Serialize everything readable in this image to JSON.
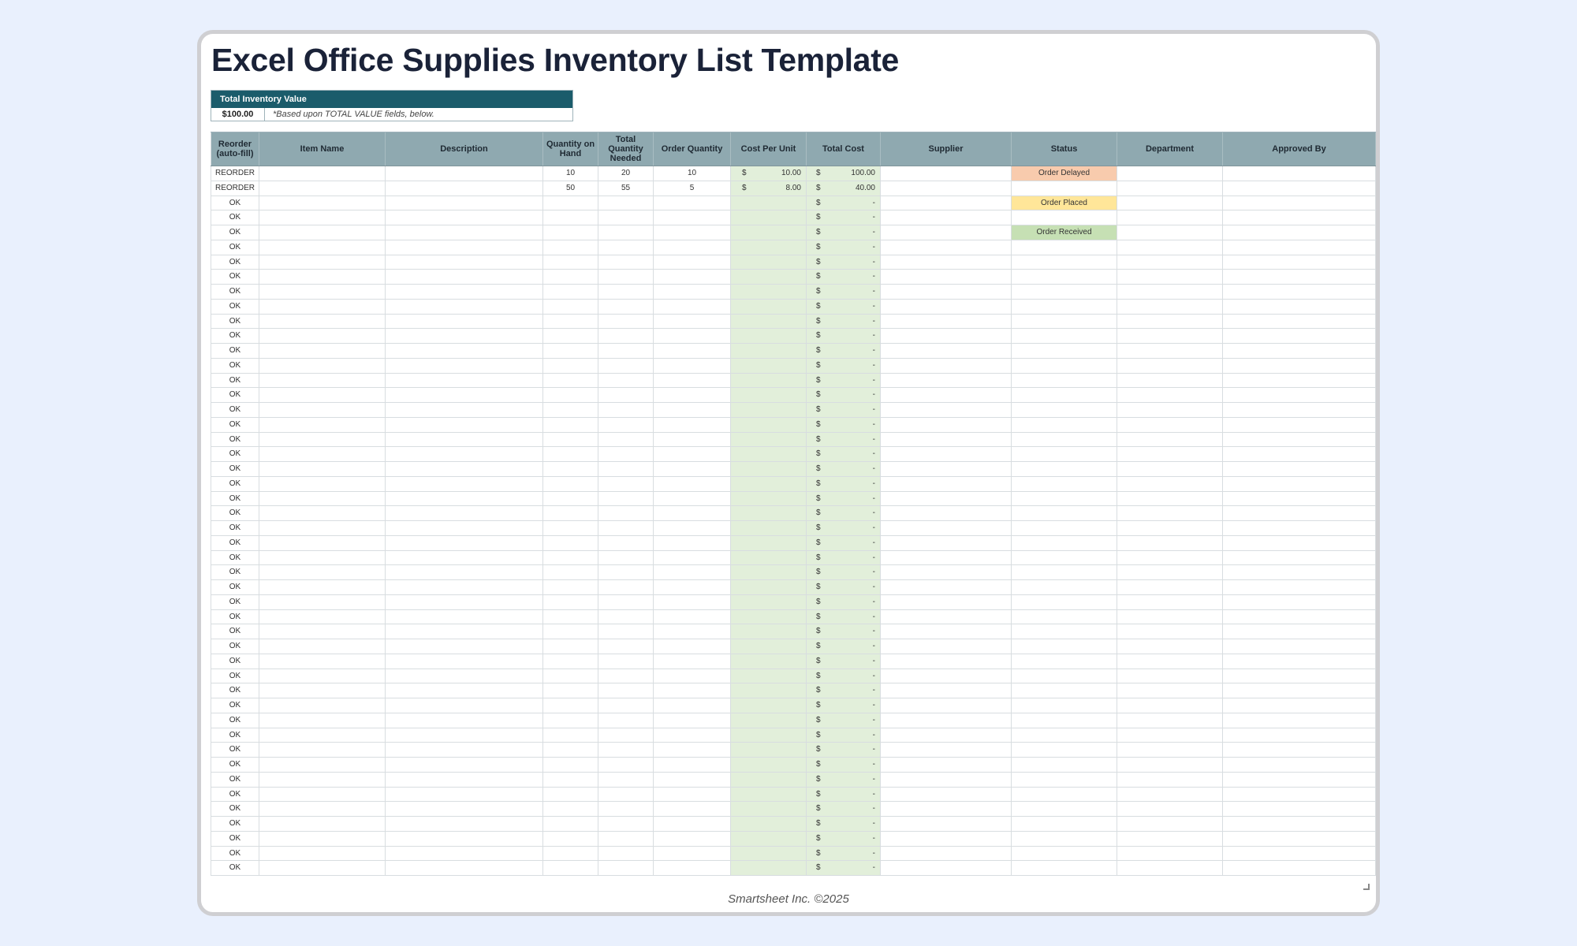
{
  "title": "Excel Office Supplies Inventory List Template",
  "inventory": {
    "header": "Total Inventory Value",
    "value": "$100.00",
    "note": "*Based upon TOTAL VALUE fields, below."
  },
  "columns": [
    "Reorder\n(auto-fill)",
    "Item Name",
    "Description",
    "Quantity on\nHand",
    "Total\nQuantity\nNeeded",
    "Order Quantity",
    "Cost Per Unit",
    "Total Cost",
    "Supplier",
    "Status",
    "Department",
    "Approved By"
  ],
  "currency_symbol": "$",
  "rows": [
    {
      "reorder": "REORDER",
      "item": "",
      "desc": "",
      "qoh": "10",
      "tqn": "20",
      "oq": "10",
      "cpu": "10.00",
      "tc": "100.00",
      "supplier": "",
      "status": "Order Delayed",
      "dept": "",
      "approved": ""
    },
    {
      "reorder": "REORDER",
      "item": "",
      "desc": "",
      "qoh": "50",
      "tqn": "55",
      "oq": "5",
      "cpu": "8.00",
      "tc": "40.00",
      "supplier": "",
      "status": "",
      "dept": "",
      "approved": ""
    },
    {
      "reorder": "OK",
      "item": "",
      "desc": "",
      "qoh": "",
      "tqn": "",
      "oq": "",
      "cpu": "",
      "tc": "-",
      "supplier": "",
      "status": "Order Placed",
      "dept": "",
      "approved": ""
    },
    {
      "reorder": "OK",
      "item": "",
      "desc": "",
      "qoh": "",
      "tqn": "",
      "oq": "",
      "cpu": "",
      "tc": "-",
      "supplier": "",
      "status": "",
      "dept": "",
      "approved": ""
    },
    {
      "reorder": "OK",
      "item": "",
      "desc": "",
      "qoh": "",
      "tqn": "",
      "oq": "",
      "cpu": "",
      "tc": "-",
      "supplier": "",
      "status": "Order Received",
      "dept": "",
      "approved": ""
    },
    {
      "reorder": "OK",
      "item": "",
      "desc": "",
      "qoh": "",
      "tqn": "",
      "oq": "",
      "cpu": "",
      "tc": "-",
      "supplier": "",
      "status": "",
      "dept": "",
      "approved": ""
    },
    {
      "reorder": "OK",
      "item": "",
      "desc": "",
      "qoh": "",
      "tqn": "",
      "oq": "",
      "cpu": "",
      "tc": "-",
      "supplier": "",
      "status": "",
      "dept": "",
      "approved": ""
    },
    {
      "reorder": "OK",
      "item": "",
      "desc": "",
      "qoh": "",
      "tqn": "",
      "oq": "",
      "cpu": "",
      "tc": "-",
      "supplier": "",
      "status": "",
      "dept": "",
      "approved": ""
    },
    {
      "reorder": "OK",
      "item": "",
      "desc": "",
      "qoh": "",
      "tqn": "",
      "oq": "",
      "cpu": "",
      "tc": "-",
      "supplier": "",
      "status": "",
      "dept": "",
      "approved": ""
    },
    {
      "reorder": "OK",
      "item": "",
      "desc": "",
      "qoh": "",
      "tqn": "",
      "oq": "",
      "cpu": "",
      "tc": "-",
      "supplier": "",
      "status": "",
      "dept": "",
      "approved": ""
    },
    {
      "reorder": "OK",
      "item": "",
      "desc": "",
      "qoh": "",
      "tqn": "",
      "oq": "",
      "cpu": "",
      "tc": "-",
      "supplier": "",
      "status": "",
      "dept": "",
      "approved": ""
    },
    {
      "reorder": "OK",
      "item": "",
      "desc": "",
      "qoh": "",
      "tqn": "",
      "oq": "",
      "cpu": "",
      "tc": "-",
      "supplier": "",
      "status": "",
      "dept": "",
      "approved": ""
    },
    {
      "reorder": "OK",
      "item": "",
      "desc": "",
      "qoh": "",
      "tqn": "",
      "oq": "",
      "cpu": "",
      "tc": "-",
      "supplier": "",
      "status": "",
      "dept": "",
      "approved": ""
    },
    {
      "reorder": "OK",
      "item": "",
      "desc": "",
      "qoh": "",
      "tqn": "",
      "oq": "",
      "cpu": "",
      "tc": "-",
      "supplier": "",
      "status": "",
      "dept": "",
      "approved": ""
    },
    {
      "reorder": "OK",
      "item": "",
      "desc": "",
      "qoh": "",
      "tqn": "",
      "oq": "",
      "cpu": "",
      "tc": "-",
      "supplier": "",
      "status": "",
      "dept": "",
      "approved": ""
    },
    {
      "reorder": "OK",
      "item": "",
      "desc": "",
      "qoh": "",
      "tqn": "",
      "oq": "",
      "cpu": "",
      "tc": "-",
      "supplier": "",
      "status": "",
      "dept": "",
      "approved": ""
    },
    {
      "reorder": "OK",
      "item": "",
      "desc": "",
      "qoh": "",
      "tqn": "",
      "oq": "",
      "cpu": "",
      "tc": "-",
      "supplier": "",
      "status": "",
      "dept": "",
      "approved": ""
    },
    {
      "reorder": "OK",
      "item": "",
      "desc": "",
      "qoh": "",
      "tqn": "",
      "oq": "",
      "cpu": "",
      "tc": "-",
      "supplier": "",
      "status": "",
      "dept": "",
      "approved": ""
    },
    {
      "reorder": "OK",
      "item": "",
      "desc": "",
      "qoh": "",
      "tqn": "",
      "oq": "",
      "cpu": "",
      "tc": "-",
      "supplier": "",
      "status": "",
      "dept": "",
      "approved": ""
    },
    {
      "reorder": "OK",
      "item": "",
      "desc": "",
      "qoh": "",
      "tqn": "",
      "oq": "",
      "cpu": "",
      "tc": "-",
      "supplier": "",
      "status": "",
      "dept": "",
      "approved": ""
    },
    {
      "reorder": "OK",
      "item": "",
      "desc": "",
      "qoh": "",
      "tqn": "",
      "oq": "",
      "cpu": "",
      "tc": "-",
      "supplier": "",
      "status": "",
      "dept": "",
      "approved": ""
    },
    {
      "reorder": "OK",
      "item": "",
      "desc": "",
      "qoh": "",
      "tqn": "",
      "oq": "",
      "cpu": "",
      "tc": "-",
      "supplier": "",
      "status": "",
      "dept": "",
      "approved": ""
    },
    {
      "reorder": "OK",
      "item": "",
      "desc": "",
      "qoh": "",
      "tqn": "",
      "oq": "",
      "cpu": "",
      "tc": "-",
      "supplier": "",
      "status": "",
      "dept": "",
      "approved": ""
    },
    {
      "reorder": "OK",
      "item": "",
      "desc": "",
      "qoh": "",
      "tqn": "",
      "oq": "",
      "cpu": "",
      "tc": "-",
      "supplier": "",
      "status": "",
      "dept": "",
      "approved": ""
    },
    {
      "reorder": "OK",
      "item": "",
      "desc": "",
      "qoh": "",
      "tqn": "",
      "oq": "",
      "cpu": "",
      "tc": "-",
      "supplier": "",
      "status": "",
      "dept": "",
      "approved": ""
    },
    {
      "reorder": "OK",
      "item": "",
      "desc": "",
      "qoh": "",
      "tqn": "",
      "oq": "",
      "cpu": "",
      "tc": "-",
      "supplier": "",
      "status": "",
      "dept": "",
      "approved": ""
    },
    {
      "reorder": "OK",
      "item": "",
      "desc": "",
      "qoh": "",
      "tqn": "",
      "oq": "",
      "cpu": "",
      "tc": "-",
      "supplier": "",
      "status": "",
      "dept": "",
      "approved": ""
    },
    {
      "reorder": "OK",
      "item": "",
      "desc": "",
      "qoh": "",
      "tqn": "",
      "oq": "",
      "cpu": "",
      "tc": "-",
      "supplier": "",
      "status": "",
      "dept": "",
      "approved": ""
    },
    {
      "reorder": "OK",
      "item": "",
      "desc": "",
      "qoh": "",
      "tqn": "",
      "oq": "",
      "cpu": "",
      "tc": "-",
      "supplier": "",
      "status": "",
      "dept": "",
      "approved": ""
    },
    {
      "reorder": "OK",
      "item": "",
      "desc": "",
      "qoh": "",
      "tqn": "",
      "oq": "",
      "cpu": "",
      "tc": "-",
      "supplier": "",
      "status": "",
      "dept": "",
      "approved": ""
    },
    {
      "reorder": "OK",
      "item": "",
      "desc": "",
      "qoh": "",
      "tqn": "",
      "oq": "",
      "cpu": "",
      "tc": "-",
      "supplier": "",
      "status": "",
      "dept": "",
      "approved": ""
    },
    {
      "reorder": "OK",
      "item": "",
      "desc": "",
      "qoh": "",
      "tqn": "",
      "oq": "",
      "cpu": "",
      "tc": "-",
      "supplier": "",
      "status": "",
      "dept": "",
      "approved": ""
    },
    {
      "reorder": "OK",
      "item": "",
      "desc": "",
      "qoh": "",
      "tqn": "",
      "oq": "",
      "cpu": "",
      "tc": "-",
      "supplier": "",
      "status": "",
      "dept": "",
      "approved": ""
    },
    {
      "reorder": "OK",
      "item": "",
      "desc": "",
      "qoh": "",
      "tqn": "",
      "oq": "",
      "cpu": "",
      "tc": "-",
      "supplier": "",
      "status": "",
      "dept": "",
      "approved": ""
    },
    {
      "reorder": "OK",
      "item": "",
      "desc": "",
      "qoh": "",
      "tqn": "",
      "oq": "",
      "cpu": "",
      "tc": "-",
      "supplier": "",
      "status": "",
      "dept": "",
      "approved": ""
    },
    {
      "reorder": "OK",
      "item": "",
      "desc": "",
      "qoh": "",
      "tqn": "",
      "oq": "",
      "cpu": "",
      "tc": "-",
      "supplier": "",
      "status": "",
      "dept": "",
      "approved": ""
    },
    {
      "reorder": "OK",
      "item": "",
      "desc": "",
      "qoh": "",
      "tqn": "",
      "oq": "",
      "cpu": "",
      "tc": "-",
      "supplier": "",
      "status": "",
      "dept": "",
      "approved": ""
    },
    {
      "reorder": "OK",
      "item": "",
      "desc": "",
      "qoh": "",
      "tqn": "",
      "oq": "",
      "cpu": "",
      "tc": "-",
      "supplier": "",
      "status": "",
      "dept": "",
      "approved": ""
    },
    {
      "reorder": "OK",
      "item": "",
      "desc": "",
      "qoh": "",
      "tqn": "",
      "oq": "",
      "cpu": "",
      "tc": "-",
      "supplier": "",
      "status": "",
      "dept": "",
      "approved": ""
    },
    {
      "reorder": "OK",
      "item": "",
      "desc": "",
      "qoh": "",
      "tqn": "",
      "oq": "",
      "cpu": "",
      "tc": "-",
      "supplier": "",
      "status": "",
      "dept": "",
      "approved": ""
    },
    {
      "reorder": "OK",
      "item": "",
      "desc": "",
      "qoh": "",
      "tqn": "",
      "oq": "",
      "cpu": "",
      "tc": "-",
      "supplier": "",
      "status": "",
      "dept": "",
      "approved": ""
    },
    {
      "reorder": "OK",
      "item": "",
      "desc": "",
      "qoh": "",
      "tqn": "",
      "oq": "",
      "cpu": "",
      "tc": "-",
      "supplier": "",
      "status": "",
      "dept": "",
      "approved": ""
    },
    {
      "reorder": "OK",
      "item": "",
      "desc": "",
      "qoh": "",
      "tqn": "",
      "oq": "",
      "cpu": "",
      "tc": "-",
      "supplier": "",
      "status": "",
      "dept": "",
      "approved": ""
    },
    {
      "reorder": "OK",
      "item": "",
      "desc": "",
      "qoh": "",
      "tqn": "",
      "oq": "",
      "cpu": "",
      "tc": "-",
      "supplier": "",
      "status": "",
      "dept": "",
      "approved": ""
    },
    {
      "reorder": "OK",
      "item": "",
      "desc": "",
      "qoh": "",
      "tqn": "",
      "oq": "",
      "cpu": "",
      "tc": "-",
      "supplier": "",
      "status": "",
      "dept": "",
      "approved": ""
    },
    {
      "reorder": "OK",
      "item": "",
      "desc": "",
      "qoh": "",
      "tqn": "",
      "oq": "",
      "cpu": "",
      "tc": "-",
      "supplier": "",
      "status": "",
      "dept": "",
      "approved": ""
    },
    {
      "reorder": "OK",
      "item": "",
      "desc": "",
      "qoh": "",
      "tqn": "",
      "oq": "",
      "cpu": "",
      "tc": "-",
      "supplier": "",
      "status": "",
      "dept": "",
      "approved": ""
    },
    {
      "reorder": "OK",
      "item": "",
      "desc": "",
      "qoh": "",
      "tqn": "",
      "oq": "",
      "cpu": "",
      "tc": "-",
      "supplier": "",
      "status": "",
      "dept": "",
      "approved": ""
    }
  ],
  "status_colors": {
    "Order Delayed": "#f8cbad",
    "Order Placed": "#ffe699",
    "Order Received": "#c6e0b4"
  },
  "colors": {
    "header_bg": "#8fa9b0",
    "inventory_header_bg": "#1b5c6b",
    "cost_columns_bg": "#e2efda",
    "page_bg": "#e9f0fd"
  },
  "footer": "Smartsheet Inc. ©2025"
}
